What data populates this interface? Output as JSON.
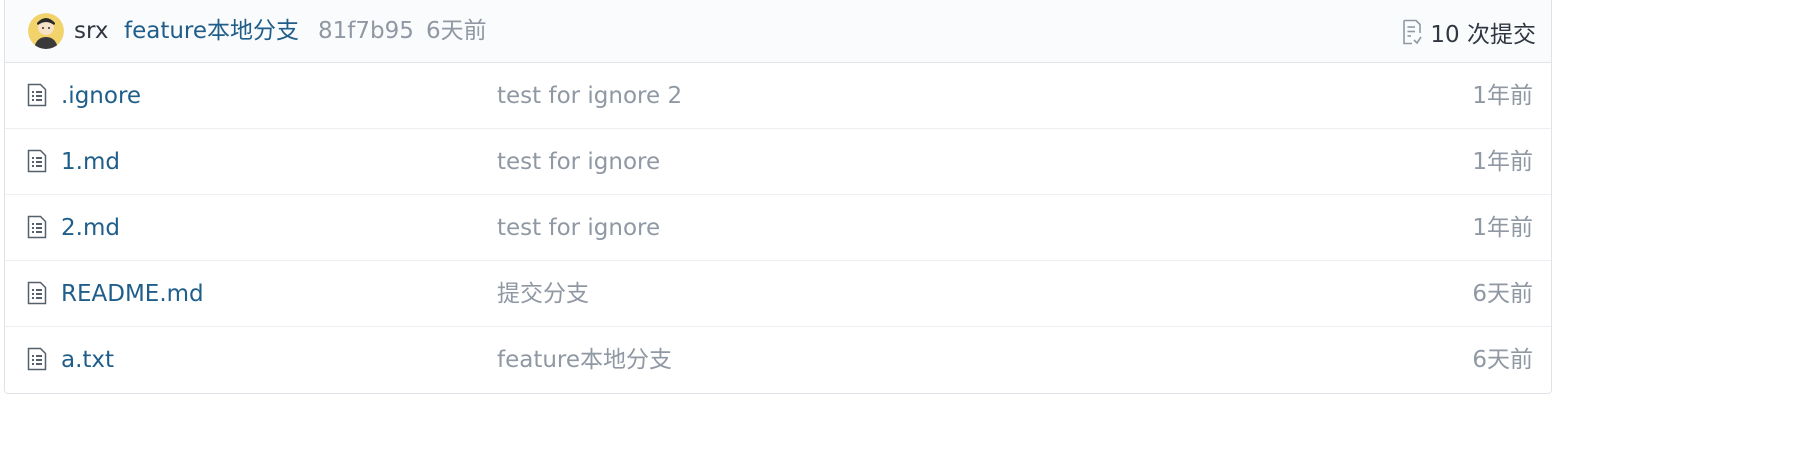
{
  "last_commit": {
    "author": "srx",
    "message": "feature本地分支",
    "sha": "81f7b95",
    "time": "6天前",
    "avatar_icon": "user-avatar"
  },
  "commit_count": {
    "label": "10 次提交",
    "icon": "commit-history-icon"
  },
  "files": [
    {
      "name": ".ignore",
      "message": "test for ignore 2",
      "time": "1年前",
      "icon": "file-icon"
    },
    {
      "name": "1.md",
      "message": "test for ignore",
      "time": "1年前",
      "icon": "file-icon"
    },
    {
      "name": "2.md",
      "message": "test for ignore",
      "time": "1年前",
      "icon": "file-icon"
    },
    {
      "name": "README.md",
      "message": "提交分支",
      "time": "6天前",
      "icon": "file-icon"
    },
    {
      "name": "a.txt",
      "message": "feature本地分支",
      "time": "6天前",
      "icon": "file-icon"
    }
  ],
  "colors": {
    "link": "#1f5e8a",
    "muted": "#8f98a3",
    "text": "#303642",
    "header_bg": "#fafbfc",
    "border": "#dfe3e8"
  }
}
